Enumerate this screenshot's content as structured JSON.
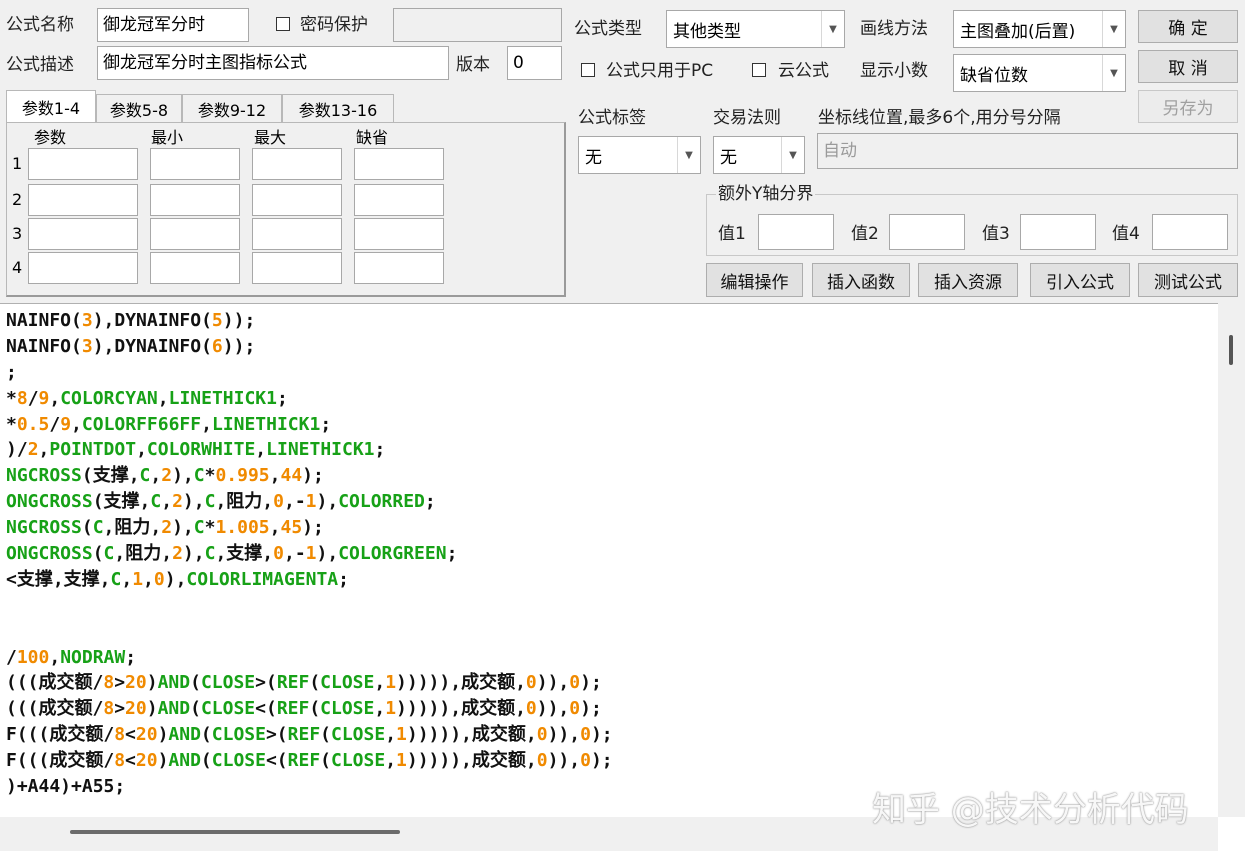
{
  "formula": {
    "name_label": "公式名称",
    "name_value": "御龙冠军分时",
    "password_label": "密码保护",
    "desc_label": "公式描述",
    "desc_value": "御龙冠军分时主图指标公式",
    "version_label": "版本",
    "version_value": "0",
    "type_label": "公式类型",
    "type_value": "其他类型",
    "draw_label": "画线方法",
    "draw_value": "主图叠加(后置)",
    "pc_only_label": "公式只用于PC",
    "cloud_label": "云公式",
    "decimals_label": "显示小数",
    "decimals_value": "缺省位数",
    "tag_label": "公式标签",
    "tag_value": "无",
    "trade_label": "交易法则",
    "trade_value": "无",
    "coord_label": "坐标线位置,最多6个,用分号分隔",
    "coord_placeholder": "自动",
    "yaxis_legend": "额外Y轴分界",
    "y_values": [
      "值1",
      "值2",
      "值3",
      "值4"
    ]
  },
  "buttons": {
    "ok": "确  定",
    "cancel": "取  消",
    "save_as": "另存为",
    "edit_ops": "编辑操作",
    "insert_func": "插入函数",
    "insert_res": "插入资源",
    "import_formula": "引入公式",
    "test_formula": "测试公式"
  },
  "params": {
    "tabs": [
      "参数1-4",
      "参数5-8",
      "参数9-12",
      "参数13-16"
    ],
    "headers": [
      "参数",
      "最小",
      "最大",
      "缺省"
    ],
    "rows": [
      "1",
      "2",
      "3",
      "4"
    ]
  },
  "code_lines": [
    [
      [
        "NAINFO(",
        "t"
      ],
      [
        "3",
        "n"
      ],
      [
        "),DYNAINFO(",
        "t"
      ],
      [
        "5",
        "n"
      ],
      [
        "));",
        "t"
      ]
    ],
    [
      [
        "NAINFO(",
        "t"
      ],
      [
        "3",
        "n"
      ],
      [
        "),DYNAINFO(",
        "t"
      ],
      [
        "6",
        "n"
      ],
      [
        "));",
        "t"
      ]
    ],
    [
      [
        ";",
        "t"
      ]
    ],
    [
      [
        "*",
        "t"
      ],
      [
        "8",
        "n"
      ],
      [
        "/",
        "t"
      ],
      [
        "9",
        "n"
      ],
      [
        ",",
        "t"
      ],
      [
        "COLORCYAN",
        "k"
      ],
      [
        ",",
        "t"
      ],
      [
        "LINETHICK1",
        "k"
      ],
      [
        ";",
        "t"
      ]
    ],
    [
      [
        "*",
        "t"
      ],
      [
        "0.5",
        "n"
      ],
      [
        "/",
        "t"
      ],
      [
        "9",
        "n"
      ],
      [
        ",",
        "t"
      ],
      [
        "COLORFF66FF",
        "k"
      ],
      [
        ",",
        "t"
      ],
      [
        "LINETHICK1",
        "k"
      ],
      [
        ";",
        "t"
      ]
    ],
    [
      [
        ")/",
        "t"
      ],
      [
        "2",
        "n"
      ],
      [
        ",",
        "t"
      ],
      [
        "POINTDOT",
        "k"
      ],
      [
        ",",
        "t"
      ],
      [
        "COLORWHITE",
        "k"
      ],
      [
        ",",
        "t"
      ],
      [
        "LINETHICK1",
        "k"
      ],
      [
        ";",
        "t"
      ]
    ],
    [
      [
        "NGCROSS",
        "k"
      ],
      [
        "(支撑,",
        "t"
      ],
      [
        "C",
        "k"
      ],
      [
        ",",
        "t"
      ],
      [
        "2",
        "n"
      ],
      [
        "),",
        "t"
      ],
      [
        "C",
        "k"
      ],
      [
        "*",
        "t"
      ],
      [
        "0.995",
        "n"
      ],
      [
        ",",
        "t"
      ],
      [
        "44",
        "n"
      ],
      [
        ");",
        "t"
      ]
    ],
    [
      [
        "ONGCROSS",
        "k"
      ],
      [
        "(支撑,",
        "t"
      ],
      [
        "C",
        "k"
      ],
      [
        ",",
        "t"
      ],
      [
        "2",
        "n"
      ],
      [
        "),",
        "t"
      ],
      [
        "C",
        "k"
      ],
      [
        ",阻力,",
        "t"
      ],
      [
        "0",
        "n"
      ],
      [
        ",-",
        "t"
      ],
      [
        "1",
        "n"
      ],
      [
        "),",
        "t"
      ],
      [
        "COLORRED",
        "k"
      ],
      [
        ";",
        "t"
      ]
    ],
    [
      [
        "NGCROSS",
        "k"
      ],
      [
        "(",
        "t"
      ],
      [
        "C",
        "k"
      ],
      [
        ",阻力,",
        "t"
      ],
      [
        "2",
        "n"
      ],
      [
        "),",
        "t"
      ],
      [
        "C",
        "k"
      ],
      [
        "*",
        "t"
      ],
      [
        "1.005",
        "n"
      ],
      [
        ",",
        "t"
      ],
      [
        "45",
        "n"
      ],
      [
        ");",
        "t"
      ]
    ],
    [
      [
        "ONGCROSS",
        "k"
      ],
      [
        "(",
        "t"
      ],
      [
        "C",
        "k"
      ],
      [
        ",阻力,",
        "t"
      ],
      [
        "2",
        "n"
      ],
      [
        "),",
        "t"
      ],
      [
        "C",
        "k"
      ],
      [
        ",支撑,",
        "t"
      ],
      [
        "0",
        "n"
      ],
      [
        ",-",
        "t"
      ],
      [
        "1",
        "n"
      ],
      [
        "),",
        "t"
      ],
      [
        "COLORGREEN",
        "k"
      ],
      [
        ";",
        "t"
      ]
    ],
    [
      [
        "<支撑,支撑,",
        "t"
      ],
      [
        "C",
        "k"
      ],
      [
        ",",
        "t"
      ],
      [
        "1",
        "n"
      ],
      [
        ",",
        "t"
      ],
      [
        "0",
        "n"
      ],
      [
        "),",
        "t"
      ],
      [
        "COLORLIMAGENTA",
        "k"
      ],
      [
        ";",
        "t"
      ]
    ],
    [],
    [],
    [
      [
        "/",
        "t"
      ],
      [
        "100",
        "n"
      ],
      [
        ",",
        "t"
      ],
      [
        "NODRAW",
        "k"
      ],
      [
        ";",
        "t"
      ]
    ],
    [
      [
        "(((成交额/",
        "t"
      ],
      [
        "8",
        "n"
      ],
      [
        ">",
        "t"
      ],
      [
        "20",
        "n"
      ],
      [
        ")",
        "t"
      ],
      [
        "AND",
        "k"
      ],
      [
        "(",
        "t"
      ],
      [
        "CLOSE",
        "k"
      ],
      [
        ">(",
        "t"
      ],
      [
        "REF",
        "k"
      ],
      [
        "(",
        "t"
      ],
      [
        "CLOSE",
        "k"
      ],
      [
        ",",
        "t"
      ],
      [
        "1",
        "n"
      ],
      [
        "))))),成交额,",
        "t"
      ],
      [
        "0",
        "n"
      ],
      [
        ")),",
        "t"
      ],
      [
        "0",
        "n"
      ],
      [
        ");",
        "t"
      ]
    ],
    [
      [
        "(((成交额/",
        "t"
      ],
      [
        "8",
        "n"
      ],
      [
        ">",
        "t"
      ],
      [
        "20",
        "n"
      ],
      [
        ")",
        "t"
      ],
      [
        "AND",
        "k"
      ],
      [
        "(",
        "t"
      ],
      [
        "CLOSE",
        "k"
      ],
      [
        "<(",
        "t"
      ],
      [
        "REF",
        "k"
      ],
      [
        "(",
        "t"
      ],
      [
        "CLOSE",
        "k"
      ],
      [
        ",",
        "t"
      ],
      [
        "1",
        "n"
      ],
      [
        "))))),成交额,",
        "t"
      ],
      [
        "0",
        "n"
      ],
      [
        ")),",
        "t"
      ],
      [
        "0",
        "n"
      ],
      [
        ");",
        "t"
      ]
    ],
    [
      [
        "F(((成交额/",
        "t"
      ],
      [
        "8",
        "n"
      ],
      [
        "<",
        "t"
      ],
      [
        "20",
        "n"
      ],
      [
        ")",
        "t"
      ],
      [
        "AND",
        "k"
      ],
      [
        "(",
        "t"
      ],
      [
        "CLOSE",
        "k"
      ],
      [
        ">(",
        "t"
      ],
      [
        "REF",
        "k"
      ],
      [
        "(",
        "t"
      ],
      [
        "CLOSE",
        "k"
      ],
      [
        ",",
        "t"
      ],
      [
        "1",
        "n"
      ],
      [
        "))))),成交额,",
        "t"
      ],
      [
        "0",
        "n"
      ],
      [
        ")),",
        "t"
      ],
      [
        "0",
        "n"
      ],
      [
        ");",
        "t"
      ]
    ],
    [
      [
        "F(((成交额/",
        "t"
      ],
      [
        "8",
        "n"
      ],
      [
        "<",
        "t"
      ],
      [
        "20",
        "n"
      ],
      [
        ")",
        "t"
      ],
      [
        "AND",
        "k"
      ],
      [
        "(",
        "t"
      ],
      [
        "CLOSE",
        "k"
      ],
      [
        "<(",
        "t"
      ],
      [
        "REF",
        "k"
      ],
      [
        "(",
        "t"
      ],
      [
        "CLOSE",
        "k"
      ],
      [
        ",",
        "t"
      ],
      [
        "1",
        "n"
      ],
      [
        "))))),成交额,",
        "t"
      ],
      [
        "0",
        "n"
      ],
      [
        ")),",
        "t"
      ],
      [
        "0",
        "n"
      ],
      [
        ");",
        "t"
      ]
    ],
    [
      [
        ")+A44)+A55;",
        "t"
      ]
    ]
  ],
  "watermark": "知乎 @技术分析代码",
  "colors": {
    "number": "#f08a00",
    "keyword": "#17a117",
    "text": "#111111"
  }
}
